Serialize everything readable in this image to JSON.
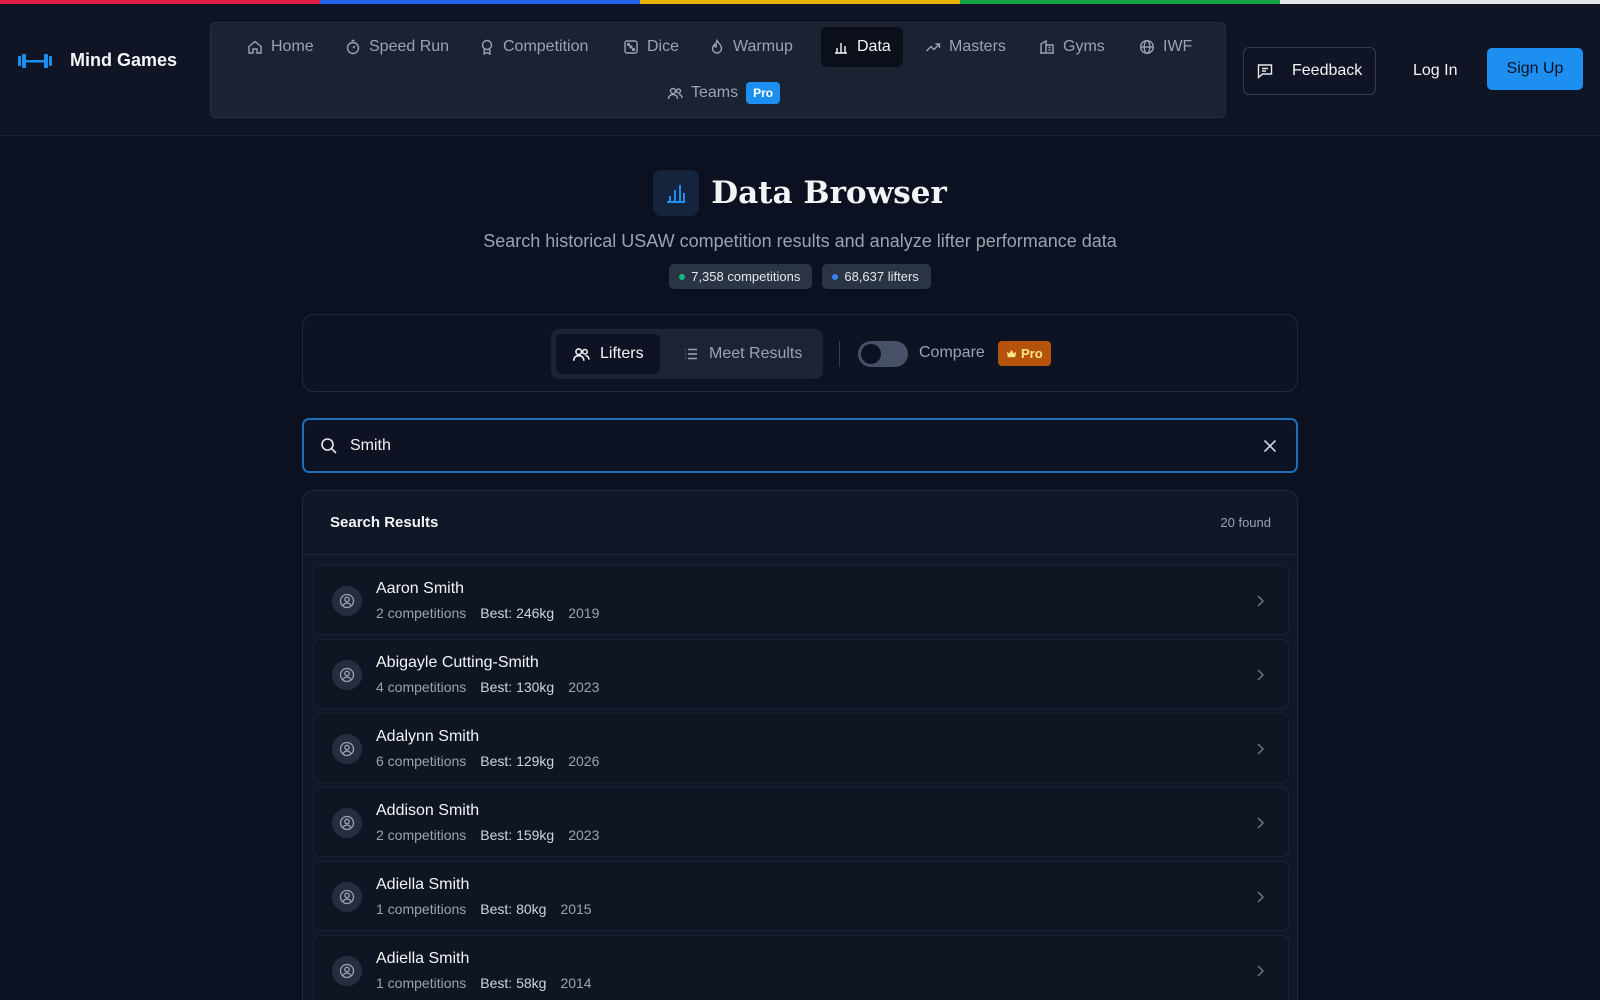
{
  "colors": {
    "accent_stripes": [
      "#e11d48",
      "#2563eb",
      "#eab308",
      "#16a34a",
      "#e5e7eb"
    ],
    "primary": "#1d8ff0",
    "pro_orange": "#b45309",
    "dot_competitions": "#10b981",
    "dot_lifters": "#3b82f6"
  },
  "header": {
    "brand": "Mind Games",
    "nav": [
      {
        "label": "Home",
        "icon": "home-icon"
      },
      {
        "label": "Speed Run",
        "icon": "stopwatch-icon"
      },
      {
        "label": "Competition",
        "icon": "medal-icon"
      },
      {
        "label": "Dice",
        "icon": "dice-icon"
      },
      {
        "label": "Warmup",
        "icon": "flame-icon"
      },
      {
        "label": "Data",
        "icon": "bar-chart-icon",
        "active": true
      },
      {
        "label": "Masters",
        "icon": "trending-up-icon"
      },
      {
        "label": "Gyms",
        "icon": "building-icon"
      },
      {
        "label": "IWF",
        "icon": "globe-icon"
      },
      {
        "label": "Teams",
        "icon": "users-icon",
        "badge": "Pro"
      }
    ],
    "feedback_label": "Feedback",
    "login_label": "Log In",
    "signup_label": "Sign Up"
  },
  "hero": {
    "title": "Data Browser",
    "subtitle": "Search historical USAW competition results and analyze lifter performance data",
    "stats": {
      "competitions": "7,358 competitions",
      "lifters": "68,637 lifters"
    }
  },
  "mode": {
    "lifters_label": "Lifters",
    "meet_results_label": "Meet Results",
    "compare_label": "Compare",
    "compare_on": false,
    "pro_label": "Pro"
  },
  "search": {
    "value": "Smith"
  },
  "results": {
    "title": "Search Results",
    "count": "20 found",
    "items": [
      {
        "name": "Aaron Smith",
        "competitions": "2 competitions",
        "best": "Best: 246kg",
        "year": "2019"
      },
      {
        "name": "Abigayle Cutting-Smith",
        "competitions": "4 competitions",
        "best": "Best: 130kg",
        "year": "2023"
      },
      {
        "name": "Adalynn Smith",
        "competitions": "6 competitions",
        "best": "Best: 129kg",
        "year": "2026"
      },
      {
        "name": "Addison Smith",
        "competitions": "2 competitions",
        "best": "Best: 159kg",
        "year": "2023"
      },
      {
        "name": "Adiella Smith",
        "competitions": "1 competitions",
        "best": "Best: 80kg",
        "year": "2015"
      },
      {
        "name": "Adiella Smith",
        "competitions": "1 competitions",
        "best": "Best: 58kg",
        "year": "2014"
      }
    ]
  }
}
